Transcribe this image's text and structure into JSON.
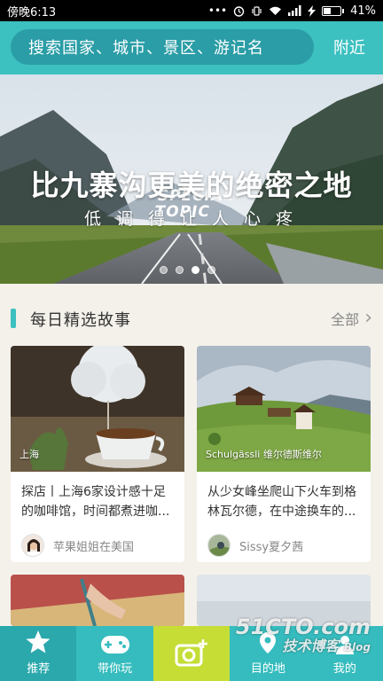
{
  "status_bar": {
    "time": "傍晚6:13",
    "battery": "41%",
    "battery_level": 0.41
  },
  "header": {
    "search_placeholder": "搜索国家、城市、景区、游记名",
    "nearby": "附近"
  },
  "banner": {
    "tag_line1": "SPECIAL",
    "tag_line2": "TOPIC",
    "title": "比九寨沟更美的绝密之地",
    "subtitle": "低调得让人心疼",
    "page_count": 4,
    "active_page": 3
  },
  "section": {
    "title": "每日精选故事",
    "more": "全部"
  },
  "cards": [
    {
      "location": "上海",
      "description": "探店丨上海6家设计感十足的咖啡馆，时间都煮进咖...",
      "author": "苹果姐姐在美国"
    },
    {
      "location": "Schulgässli 维尔德斯维尔",
      "description": "从少女峰坐爬山下火车到格林瓦尔德，在中途换车的...",
      "author": "Sissy夏夕茜"
    }
  ],
  "nav": {
    "items": [
      {
        "label": "推荐",
        "icon": "star-icon",
        "selected": true
      },
      {
        "label": "带你玩",
        "icon": "gamepad-icon"
      },
      {
        "label": "",
        "icon": "camera-plus-icon"
      },
      {
        "label": "目的地",
        "icon": "location-icon"
      },
      {
        "label": "我的",
        "icon": "profile-icon"
      }
    ]
  },
  "watermark": {
    "line1": "51CTO.com",
    "line2": "技术博客",
    "line3": "Blog"
  },
  "colors": {
    "accent": "#3cc0c0",
    "search_bg": "#2a9da6",
    "camera": "#c6dd36"
  }
}
